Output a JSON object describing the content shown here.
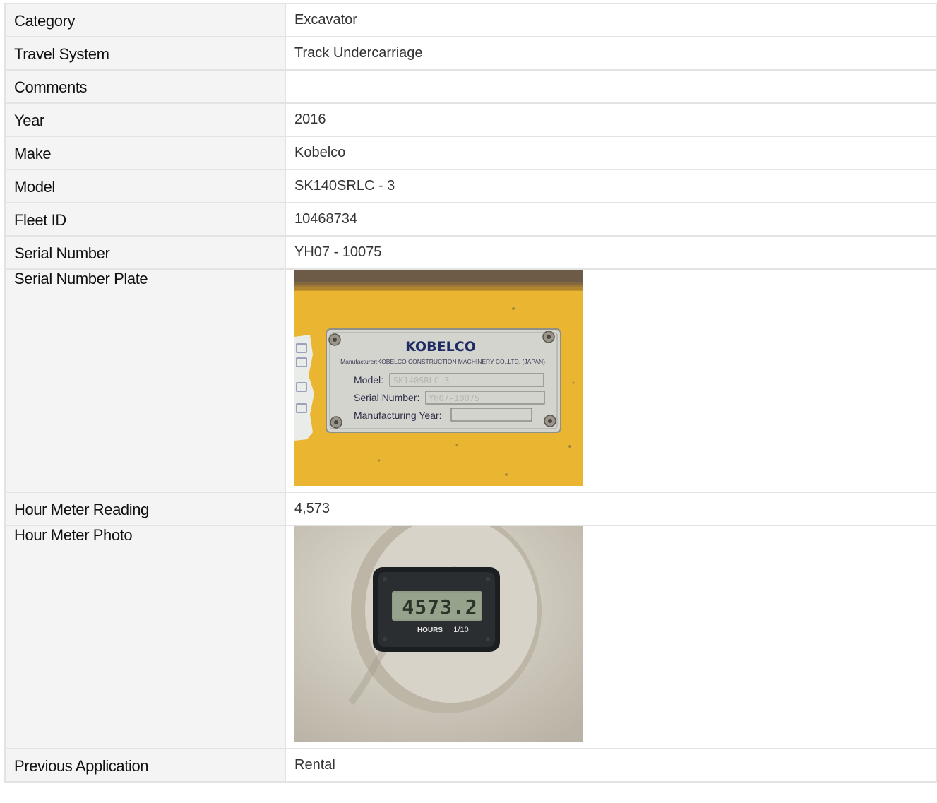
{
  "rows": [
    {
      "label": "Category",
      "value": "Excavator"
    },
    {
      "label": "Travel System",
      "value": "Track Undercarriage"
    },
    {
      "label": "Comments",
      "value": ""
    },
    {
      "label": "Year",
      "value": "2016"
    },
    {
      "label": "Make",
      "value": "Kobelco"
    },
    {
      "label": "Model",
      "value": "SK140SRLC - 3"
    },
    {
      "label": "Fleet ID",
      "value": "10468734"
    },
    {
      "label": "Serial Number",
      "value": "YH07 - 10075"
    },
    {
      "label": "Serial Number Plate",
      "value": null
    },
    {
      "label": "Hour Meter Reading",
      "value": "4,573"
    },
    {
      "label": "Hour Meter Photo",
      "value": null
    },
    {
      "label": "Previous Application",
      "value": "Rental"
    }
  ],
  "plate_photo": {
    "brand": "KOBELCO",
    "manufacturer_line": "Manufacturer:KOBELCO CONSTRUCTION MACHINERY CO.,LTD. (JAPAN)",
    "model_label": "Model:",
    "model_value": "SK140SRLC-3",
    "serial_label": "Serial Number:",
    "serial_value": "YH07-10075",
    "year_label": "Manufacturing Year:",
    "colors": {
      "body": "#e8b32a",
      "plate": "#d9d9d4",
      "rust": "#6b5a46"
    }
  },
  "meter_photo": {
    "display": "4573.2",
    "units": "HOURS",
    "fraction": "1/10",
    "colors": {
      "housing": "#d6d1c6",
      "bezel": "#1c1f22",
      "lcd": "#8f9b86"
    }
  }
}
